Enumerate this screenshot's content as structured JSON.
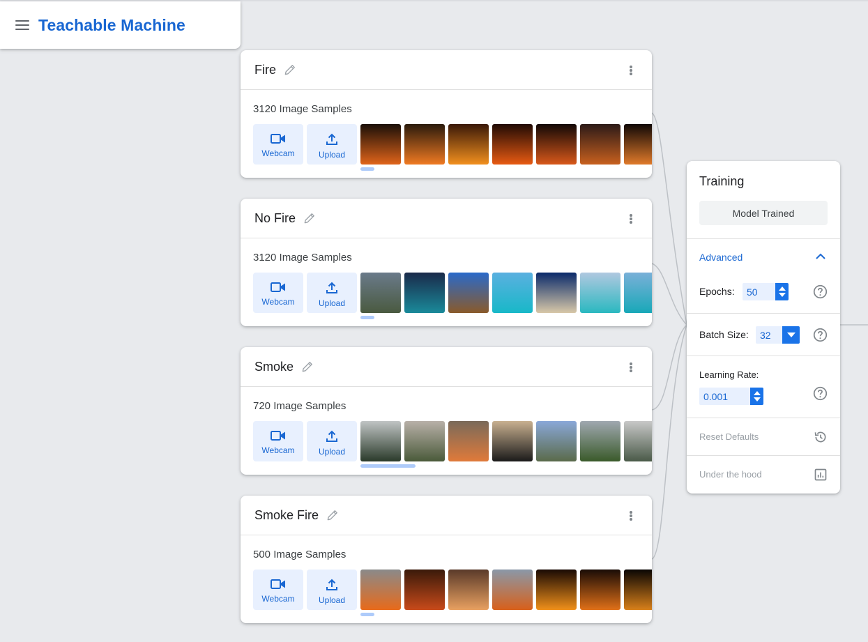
{
  "app": {
    "title": "Teachable Machine"
  },
  "classes": [
    {
      "name": "Fire",
      "sample_count": "3120 Image Samples",
      "webcam_label": "Webcam",
      "upload_label": "Upload",
      "thumb_colors": [
        [
          "#1a0f08",
          "#e0641a"
        ],
        [
          "#2a1a0c",
          "#f07a22"
        ],
        [
          "#3a1808",
          "#f2901e"
        ],
        [
          "#200a04",
          "#e85a12"
        ],
        [
          "#120806",
          "#d8581a"
        ],
        [
          "#2c1a18",
          "#c8601e"
        ],
        [
          "#100806",
          "#e07a2a"
        ]
      ]
    },
    {
      "name": "No Fire",
      "sample_count": "3120 Image Samples",
      "webcam_label": "Webcam",
      "upload_label": "Upload",
      "thumb_colors": [
        [
          "#6a7a8a",
          "#4a5a40"
        ],
        [
          "#1a2a4a",
          "#1a8a9a"
        ],
        [
          "#2a6aca",
          "#8a5a2a"
        ],
        [
          "#5ab0e0",
          "#18b8c8"
        ],
        [
          "#0a2a6a",
          "#d8c8a8"
        ],
        [
          "#b0c8e0",
          "#2ab8c0"
        ],
        [
          "#7ab0d8",
          "#18a8b8"
        ]
      ]
    },
    {
      "name": "Smoke",
      "sample_count": "720 Image Samples",
      "webcam_label": "Webcam",
      "upload_label": "Upload",
      "thumb_colors": [
        [
          "#c0c4c4",
          "#2a3a2a"
        ],
        [
          "#b8b0a8",
          "#4a5a3a"
        ],
        [
          "#7a6a5a",
          "#e07a3a"
        ],
        [
          "#c8b090",
          "#1a1a1a"
        ],
        [
          "#8aa8d8",
          "#5a6a4a"
        ],
        [
          "#a0a8b0",
          "#3a5a2a"
        ],
        [
          "#c8c8c8",
          "#4a5a48"
        ]
      ]
    },
    {
      "name": "Smoke Fire",
      "sample_count": "500 Image Samples",
      "webcam_label": "Webcam",
      "upload_label": "Upload",
      "thumb_colors": [
        [
          "#8a8a8a",
          "#e86a1a"
        ],
        [
          "#3a1a0a",
          "#c84a1a"
        ],
        [
          "#5a3a2a",
          "#e8a060"
        ],
        [
          "#8a98a8",
          "#d8601a"
        ],
        [
          "#1a0a04",
          "#f0901a"
        ],
        [
          "#1a0c06",
          "#e07018"
        ],
        [
          "#0a0604",
          "#d8801a"
        ]
      ]
    }
  ],
  "training": {
    "title": "Training",
    "status": "Model Trained",
    "advanced_label": "Advanced",
    "epochs_label": "Epochs:",
    "epochs_value": "50",
    "batch_label": "Batch Size:",
    "batch_value": "32",
    "lr_label": "Learning Rate:",
    "lr_value": "0.001",
    "reset_label": "Reset Defaults",
    "hood_label": "Under the hood"
  }
}
